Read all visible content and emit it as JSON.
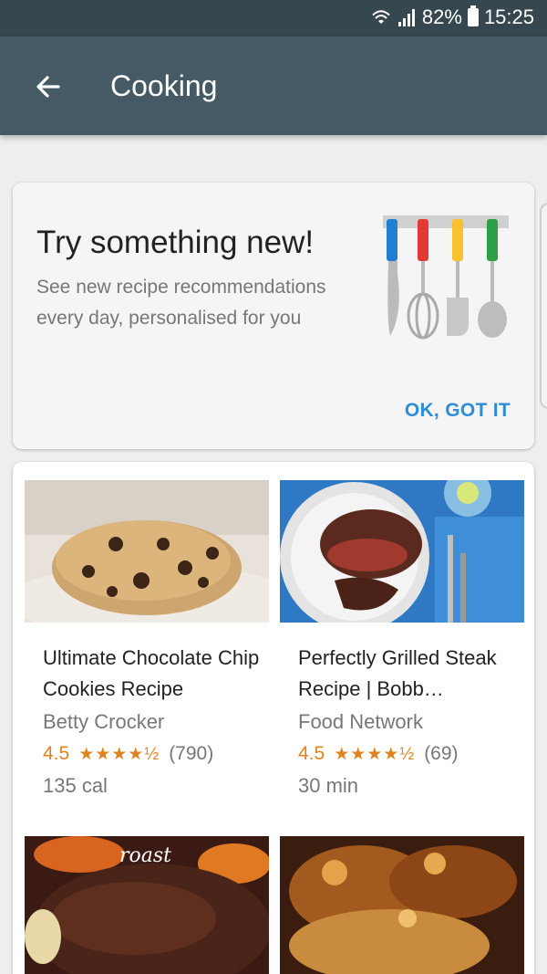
{
  "status_bar": {
    "battery": "82%",
    "time": "15:25"
  },
  "app_bar": {
    "title": "Cooking",
    "back_icon": "arrow-left-icon"
  },
  "promo": {
    "title": "Try something new!",
    "subtitle": "See new recipe recommendations every day, personalised for you",
    "action": "OK, GOT IT",
    "illustration": "hanging-kitchen-utensils"
  },
  "recipes": [
    {
      "name": "Ultimate Chocolate Chip Cookies Recipe",
      "source": "Betty Crocker",
      "rating": "4.5",
      "stars": "★★★★½",
      "reviews": "(790)",
      "meta": "135 cal",
      "image": "chocolate-chip-cookie"
    },
    {
      "name": "Perfectly Grilled Steak Recipe | Bobb…",
      "source": "Food Network",
      "rating": "4.5",
      "stars": "★★★★½",
      "reviews": "(69)",
      "meta": "30 min",
      "image": "grilled-steak"
    },
    {
      "badge": "roast",
      "image": "pot-roast"
    },
    {
      "image": "glazed-dish"
    }
  ],
  "colors": {
    "status_bar": "#37474f",
    "app_bar": "#455a64",
    "accent": "#2f8cd6",
    "rating": "#e08420"
  }
}
